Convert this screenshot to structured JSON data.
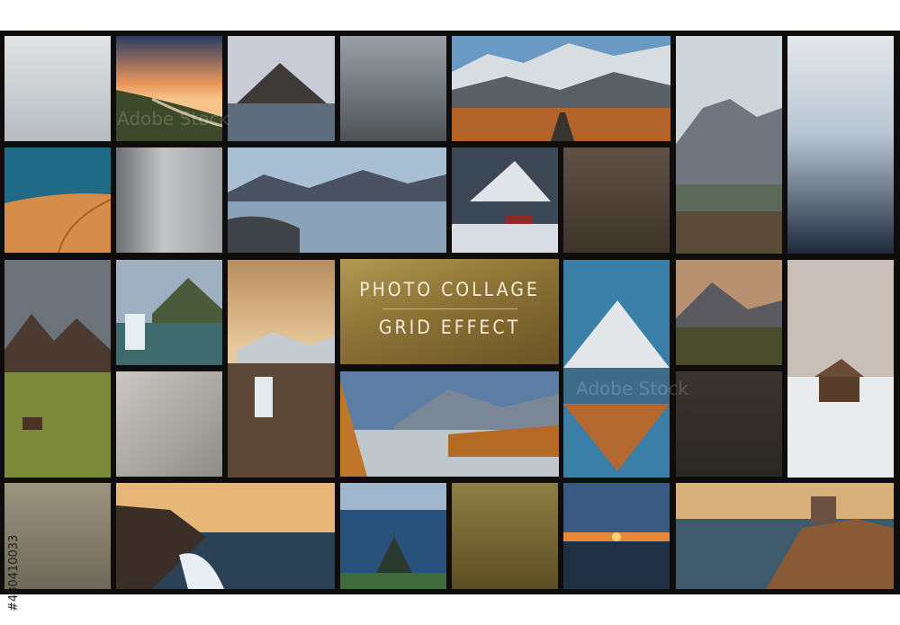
{
  "collage": {
    "title_line1": "PHOTO COLLAGE",
    "title_line2": "GRID EFFECT"
  },
  "stock_id": "#480410033",
  "watermark": "Adobe Stock",
  "colors": {
    "background": "#0e0d0c",
    "title_panel_gold": "#8c7235",
    "title_text": "#f4ecd8"
  }
}
